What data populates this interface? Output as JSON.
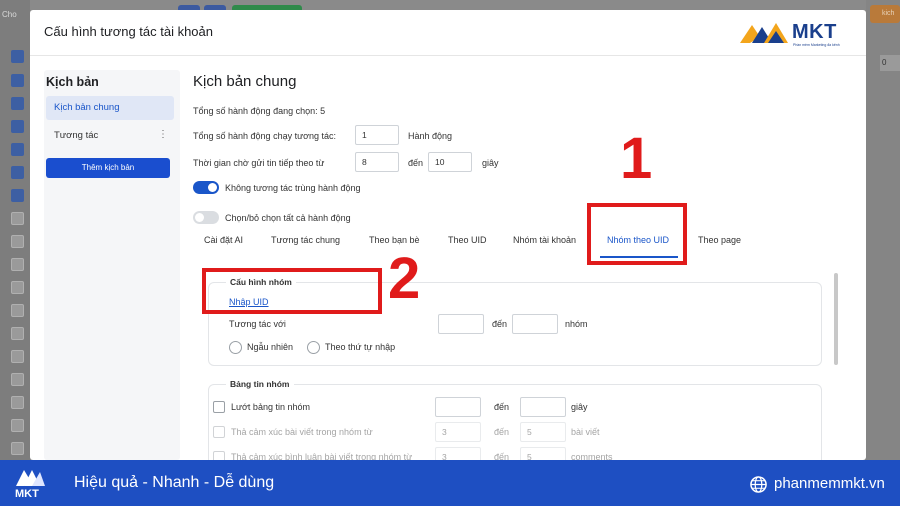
{
  "background": {
    "left_label": "Cho",
    "right_button_label": "kich",
    "right_value": "0"
  },
  "dialog": {
    "title": "Cấu hình tương tác tài khoản",
    "logo": {
      "text": "MKT",
      "tagline": "Phần mềm Marketing đa kênh"
    }
  },
  "sidebar": {
    "title": "Kịch bản",
    "items": [
      {
        "label": "Kịch bản chung",
        "active": true
      },
      {
        "label": "Tương tác",
        "active": false,
        "menu": "⋮"
      }
    ],
    "add_button": "Thêm kịch bản"
  },
  "main": {
    "title": "Kịch bản chung",
    "total_selected": "Tổng số hành động đang chọn: 5",
    "run_count_label": "Tổng số hành động chạy tương tác:",
    "run_count_value": "1",
    "run_count_unit": "Hành động",
    "wait_label": "Thời gian chờ gửi tin tiếp theo từ",
    "wait_from": "8",
    "wait_to_label": "đến",
    "wait_to": "10",
    "wait_unit": "giây",
    "no_duplicate_label": "Không tương tác trùng hành động",
    "no_duplicate_on": true,
    "select_all_label": "Chọn/bỏ chọn tất cả hành động",
    "select_all_on": false
  },
  "tabs": [
    {
      "label": "Cài đặt AI"
    },
    {
      "label": "Tương tác chung"
    },
    {
      "label": "Theo bạn bè"
    },
    {
      "label": "Theo UID"
    },
    {
      "label": "Nhóm tài khoản"
    },
    {
      "label": "Nhóm theo UID",
      "active": true
    },
    {
      "label": "Theo page"
    }
  ],
  "group_config": {
    "title": "Cấu hình nhóm",
    "link": "Nhập UID",
    "interact_label": "Tương tác với",
    "from_value": "",
    "to_label": "đến",
    "to_value": "",
    "unit": "nhóm",
    "radio_random": "Ngẫu nhiên",
    "radio_order": "Theo thứ tự nhập"
  },
  "news_feed": {
    "title": "Bảng tin nhóm",
    "rows": [
      {
        "label": "Lướt bảng tin nhóm",
        "from": "",
        "to_label": "đến",
        "to": "",
        "unit": "giây"
      },
      {
        "label": "Thả cảm xúc bài viết trong nhóm từ",
        "from": "3",
        "to_label": "đến",
        "to": "5",
        "unit": "bài viết"
      },
      {
        "label": "Thả cảm xúc bình luận bài viết trong nhóm từ",
        "from": "3",
        "to_label": "đến",
        "to": "5",
        "unit": "comments"
      }
    ]
  },
  "annotations": {
    "step1": "1",
    "step2": "2"
  },
  "footer": {
    "logo_text": "MKT",
    "slogan": "Hiệu quả - Nhanh  - Dễ dùng",
    "website": "phanmemmkt.vn"
  },
  "colors": {
    "accent": "#1a56c9",
    "footer": "#1e4fc2",
    "annotation": "#e01b1b"
  }
}
